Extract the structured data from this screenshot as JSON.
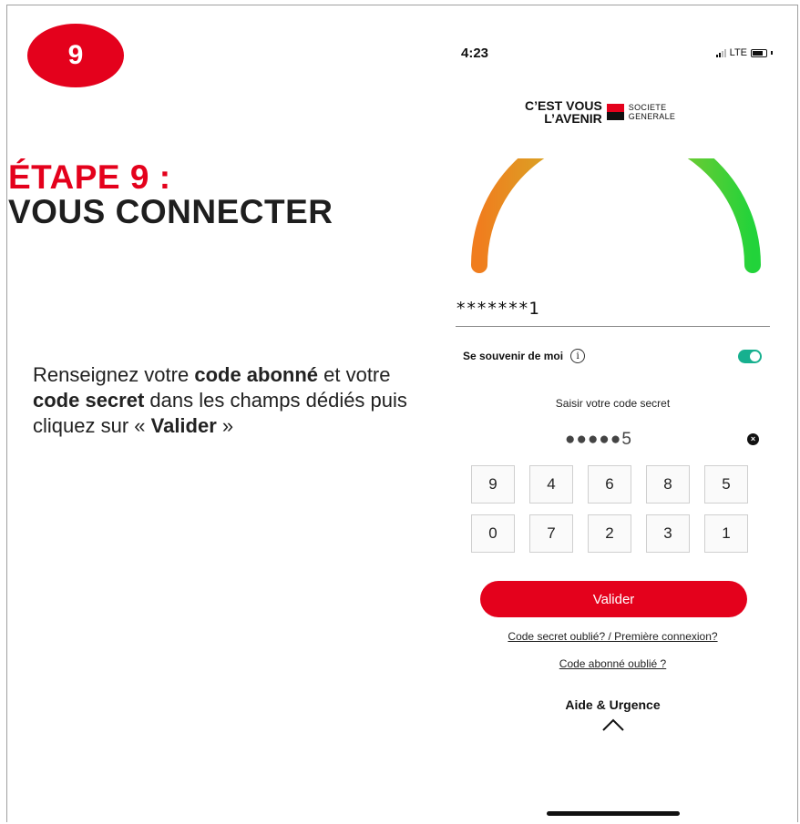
{
  "badge": {
    "number": "9"
  },
  "title": {
    "line1": "ÉTAPE 9 :",
    "line2": "VOUS CONNECTER"
  },
  "instructions": {
    "t1": "Renseignez votre ",
    "b1": "code abonné",
    "t2": " et votre ",
    "b2": "code secret",
    "t3": " dans les champs dédiés puis cliquez sur « ",
    "b3": "Valider",
    "t4": " »"
  },
  "status": {
    "time": "4:23",
    "network": "LTE"
  },
  "logo": {
    "slogan_line1": "C’EST VOUS",
    "slogan_line2": "L’AVENIR",
    "brand_line1": "SOCIETE",
    "brand_line2": "GENERALE"
  },
  "login": {
    "code_abonne": "*******1",
    "remember_label": "Se souvenir de moi",
    "remember_on": true,
    "info_glyph": "i",
    "secret_label": "Saisir votre code secret",
    "secret_value": "●●●●●5",
    "clear_glyph": "×",
    "keypad": [
      "9",
      "4",
      "6",
      "8",
      "5",
      "0",
      "7",
      "2",
      "3",
      "1"
    ],
    "validate_label": "Valider",
    "forgot_secret_link": "Code secret oublié? / Première connexion?",
    "forgot_code_link": "Code abonné oublié ?",
    "help_label": "Aide & Urgence"
  },
  "colors": {
    "brand_red": "#e4011c",
    "toggle_green": "#17b08f",
    "gauge_start": "#f07d1e",
    "gauge_end": "#22d33a"
  },
  "icons": {
    "info": "info-icon",
    "clear": "clear-icon",
    "chevron": "chevron-up-icon"
  }
}
